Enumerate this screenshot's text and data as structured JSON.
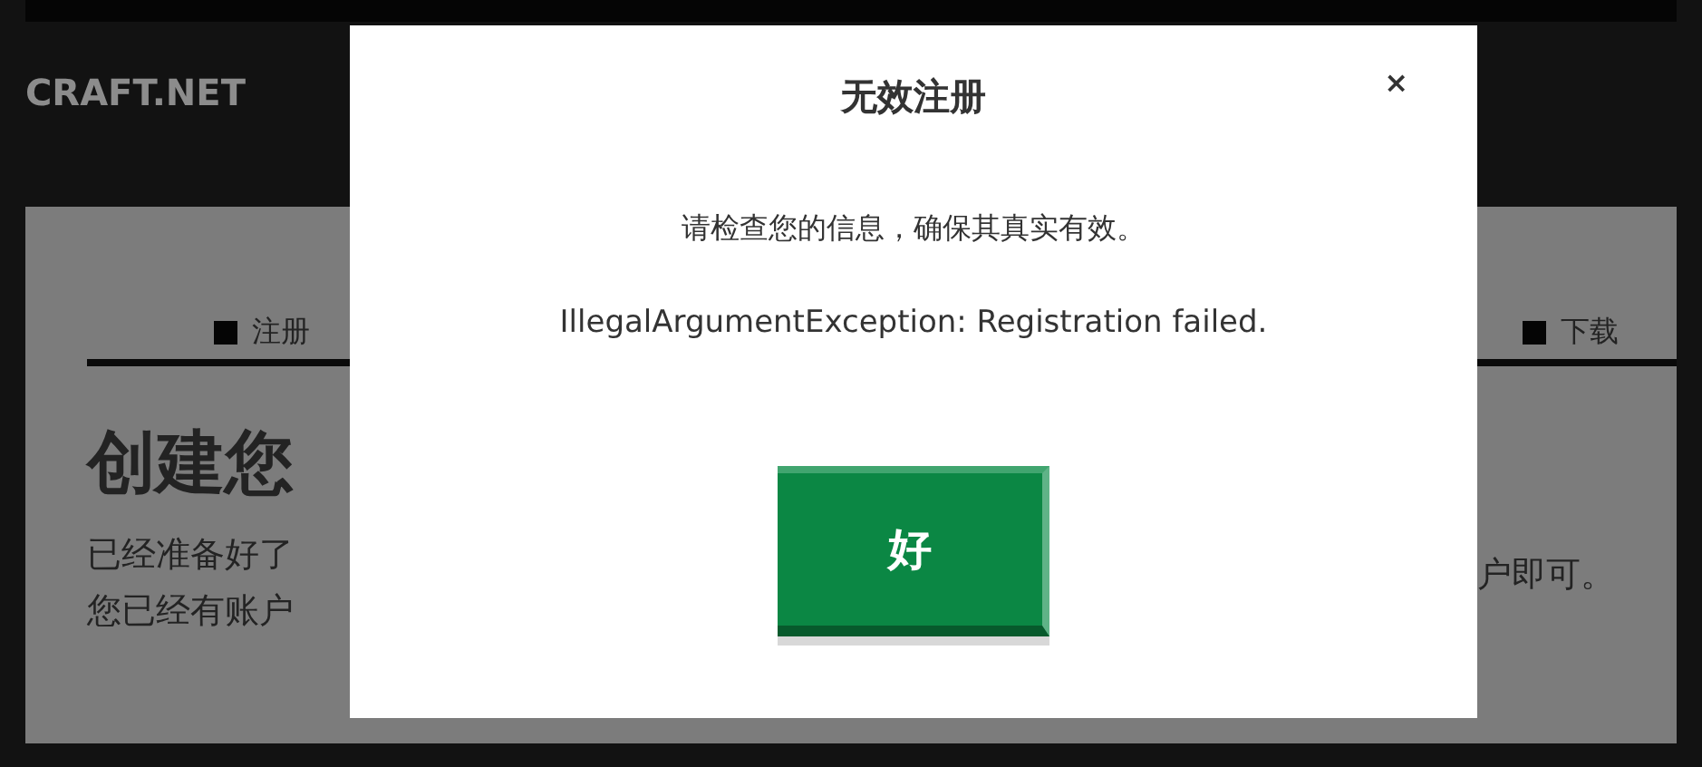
{
  "header": {
    "site_name": "CRAFT.NET"
  },
  "steps": [
    {
      "label": "注册"
    },
    {
      "label": "下载"
    }
  ],
  "page": {
    "heading": "创建您",
    "paragraph_left": [
      "已经准备好了",
      "您已经有账户"
    ],
    "paragraph_right": [
      "户即可。"
    ]
  },
  "dialog": {
    "title": "无效注册",
    "close": "×",
    "message": "请检查您的信息，确保其真实有效。",
    "error": "IllegalArgumentException: Registration failed.",
    "buttons": [
      "好"
    ]
  }
}
